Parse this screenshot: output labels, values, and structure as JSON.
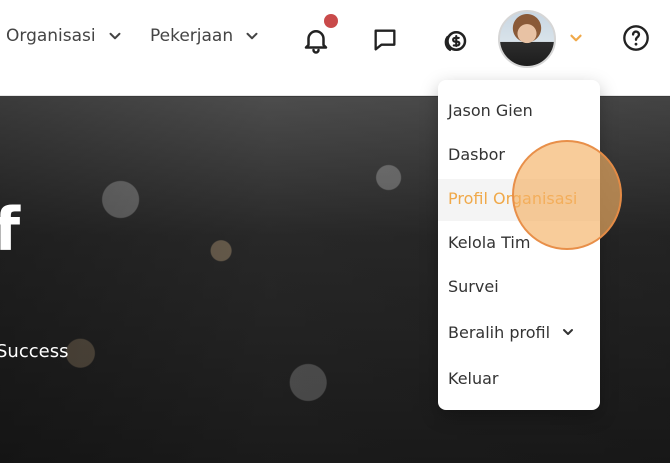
{
  "navbar": {
    "items": [
      {
        "label": "Organisasi",
        "icon": "chevron-down-icon"
      },
      {
        "label": "Pekerjaan",
        "icon": "chevron-down-icon"
      }
    ],
    "icons": [
      "bell-icon",
      "chat-icon",
      "coin-icon",
      "help-icon"
    ],
    "accent_color": "#f0a94a",
    "notification_badge_color": "#c94a4a"
  },
  "hero": {
    "big_letter": "f",
    "subtitle": "Success"
  },
  "profile_menu": {
    "items": [
      {
        "label": "Jason Gien"
      },
      {
        "label": "Dasbor"
      },
      {
        "label": "Profil Organisasi",
        "active": true
      },
      {
        "label": "Kelola Tim"
      },
      {
        "label": "Survei"
      },
      {
        "label": "Beralih profil",
        "has_chevron": true
      },
      {
        "label": "Keluar"
      }
    ]
  }
}
